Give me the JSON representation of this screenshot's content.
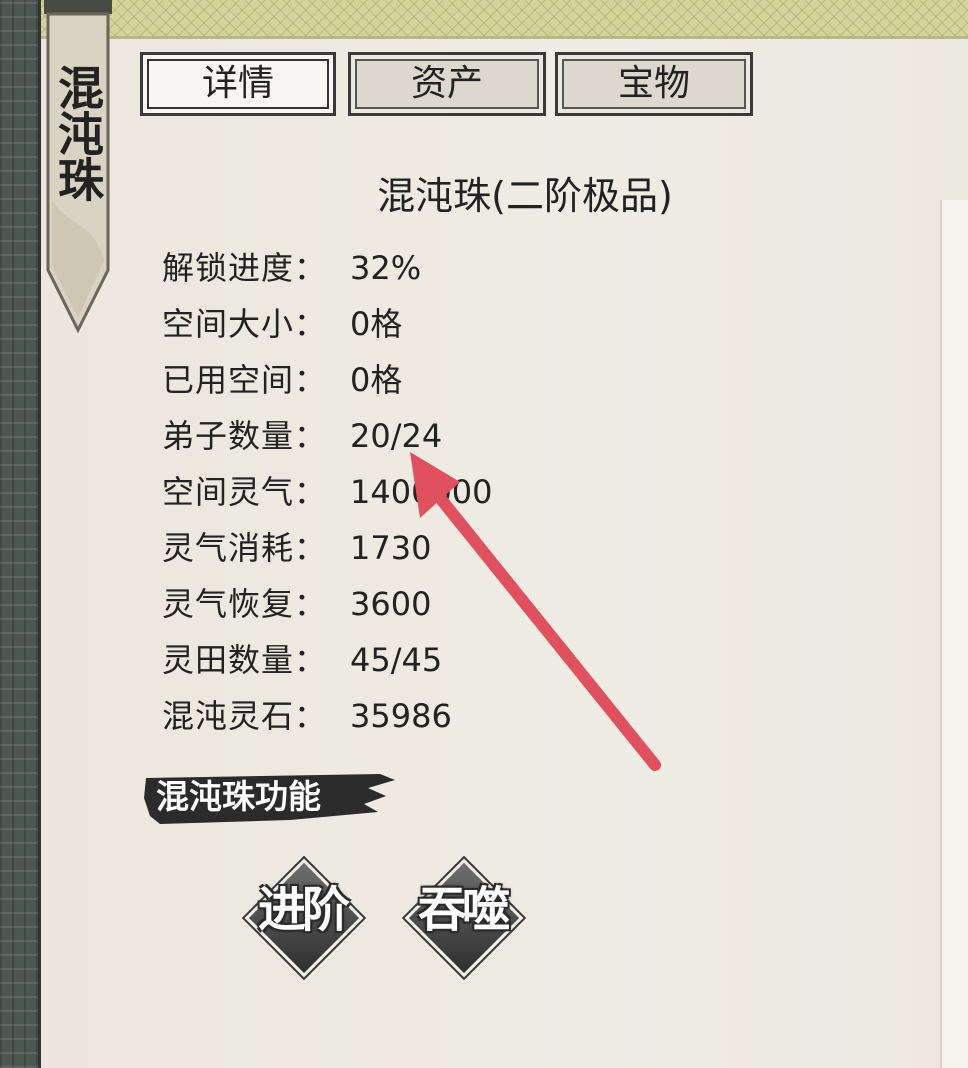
{
  "banner": {
    "title": "混沌珠"
  },
  "tabs": [
    {
      "label": "详情",
      "active": true
    },
    {
      "label": "资产",
      "active": false
    },
    {
      "label": "宝物",
      "active": false
    }
  ],
  "item": {
    "title": "混沌珠(二阶极品)"
  },
  "stats": [
    {
      "label": "解锁进度：",
      "value": "32%"
    },
    {
      "label": "空间大小：",
      "value": "0格"
    },
    {
      "label": "已用空间：",
      "value": "0格"
    },
    {
      "label": "弟子数量：",
      "value": "20/24"
    },
    {
      "label": "空间灵气：",
      "value": "1400000"
    },
    {
      "label": "灵气消耗：",
      "value": "1730"
    },
    {
      "label": "灵气恢复：",
      "value": "3600"
    },
    {
      "label": "灵田数量：",
      "value": "45/45"
    },
    {
      "label": "混沌灵石：",
      "value": "35986"
    }
  ],
  "section": {
    "label": "混沌珠功能"
  },
  "actions": {
    "advance": "进阶",
    "devour": "吞噬"
  },
  "colors": {
    "arrow": "#e0505e",
    "ink": "#2b2b2b"
  }
}
